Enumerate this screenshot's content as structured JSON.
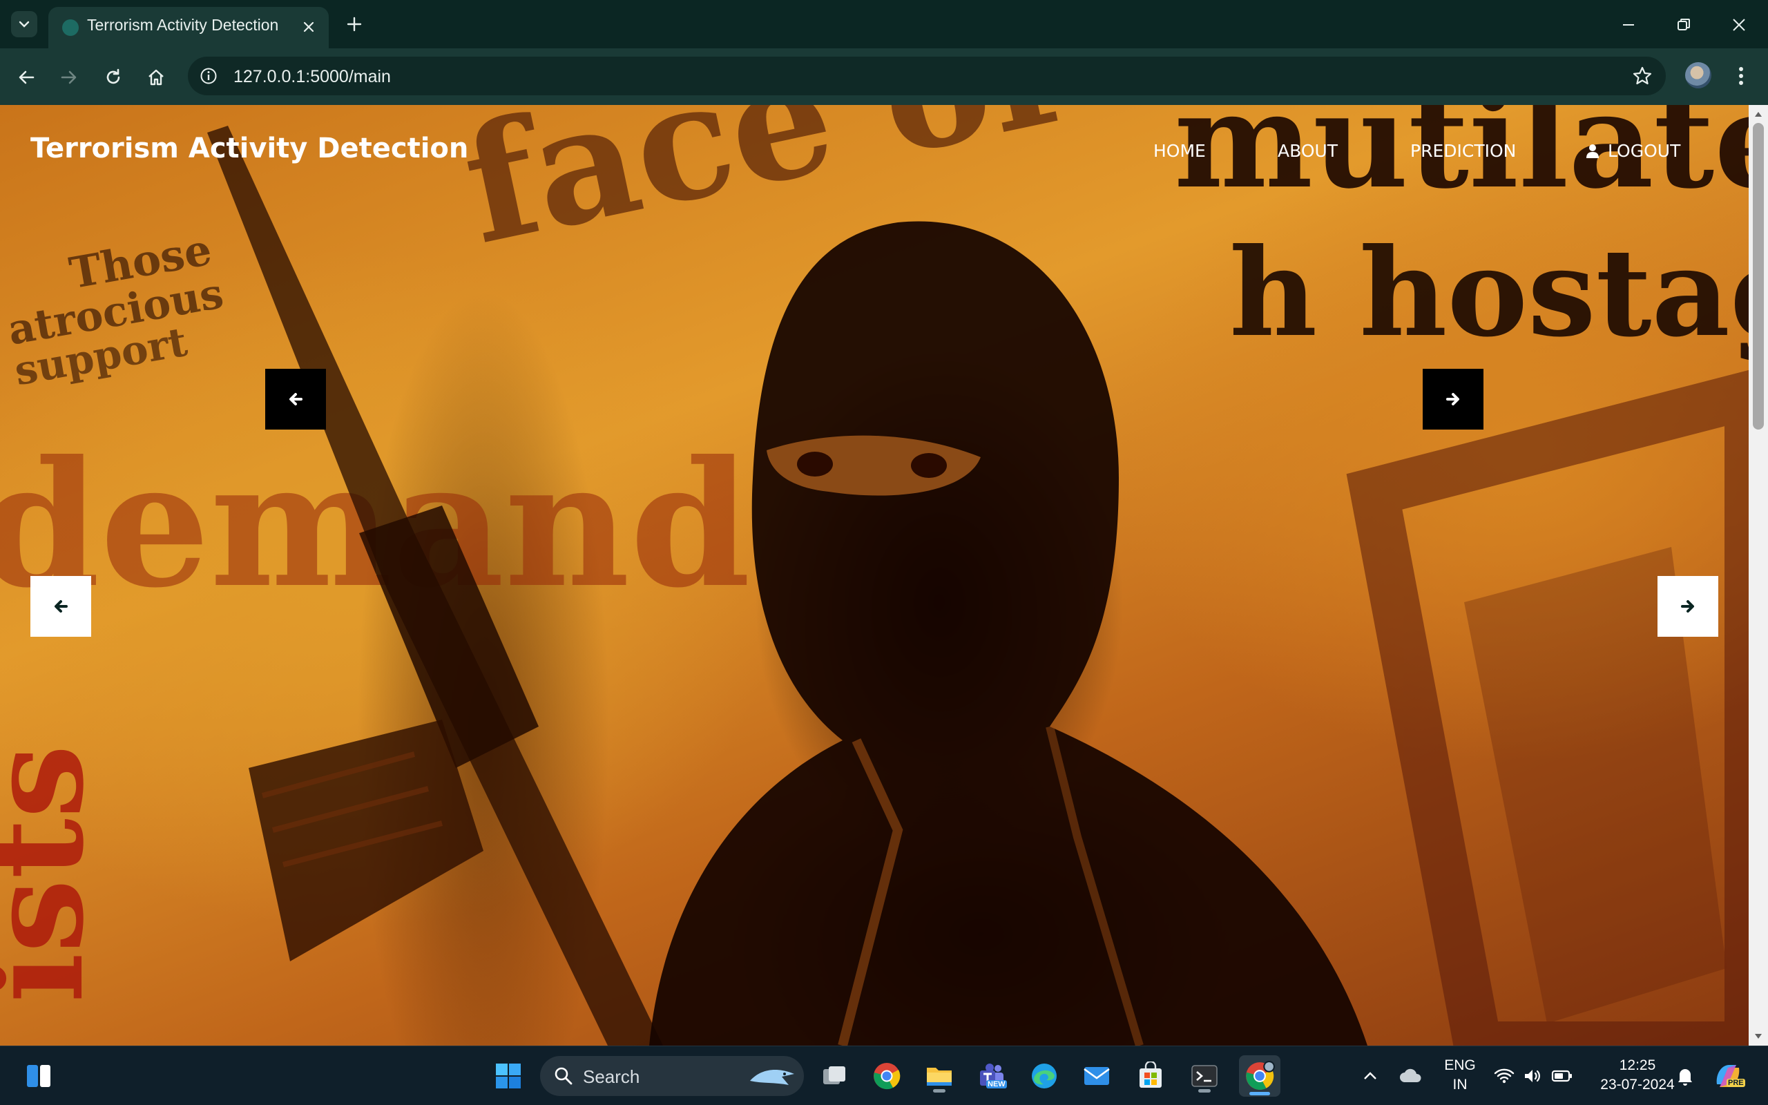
{
  "browser": {
    "tab_title": "Terrorism Activity Detection",
    "url": "127.0.0.1:5000/main",
    "icons": [
      "tab-list-icon",
      "close-icon",
      "plus-icon",
      "minimize-icon",
      "restore-icon",
      "back-icon",
      "forward-icon",
      "reload-icon",
      "home-icon",
      "site-info-icon",
      "star-icon",
      "profile-avatar",
      "more-menu-icon"
    ]
  },
  "page": {
    "brand": "Terrorism Activity Detection",
    "nav": {
      "home": "HOME",
      "about": "ABOUT",
      "prediction": "PREDICTION",
      "logout": "LOGOUT"
    },
    "hero": {
      "background_words": [
        "face of",
        "mutilated",
        "h hostage",
        "Those",
        "atrocious",
        "support",
        "demand",
        "ists"
      ],
      "colors": {
        "accent_orange": "#e39a2c",
        "dark_brown": "#1a0500"
      }
    }
  },
  "taskbar": {
    "search_placeholder": "Search",
    "language": "ENG",
    "region": "IN",
    "time": "12:25",
    "date": "23-07-2024",
    "apps": [
      "windows-start",
      "task-view",
      "chrome",
      "file-explorer",
      "teams",
      "edge",
      "mail",
      "store",
      "terminal",
      "chrome-active"
    ],
    "teams_badge": "NEW",
    "copilot_badge": "PRE"
  }
}
